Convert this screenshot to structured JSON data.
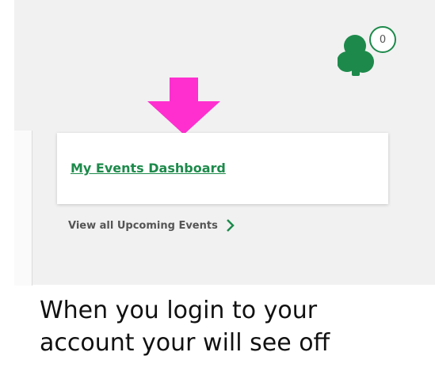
{
  "header": {
    "cart": {
      "icon": "trefoil-icon",
      "count": "0",
      "brand_color": "#1d8a4b"
    }
  },
  "annotation": {
    "icon": "arrow-down-icon",
    "color": "#ff2fcf"
  },
  "events_card": {
    "dashboard_link": "My Events Dashboard",
    "link_color": "#1d8a4b"
  },
  "view_all": {
    "label": "View all Upcoming Events",
    "icon": "chevron-right-icon"
  },
  "caption": {
    "line1": "When you login to your",
    "line2": "account your will see off"
  }
}
